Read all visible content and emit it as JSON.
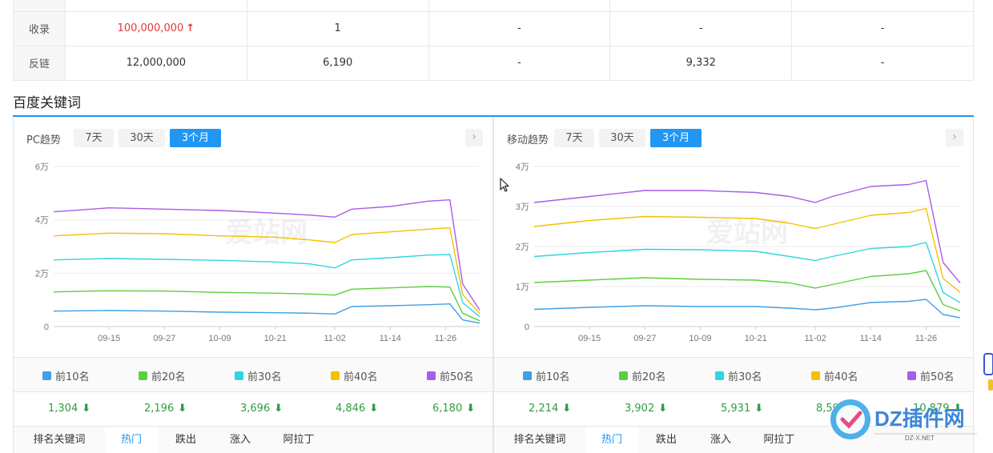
{
  "top_table": {
    "rows": [
      {
        "label": "收录",
        "values": [
          "100,000,000",
          "1",
          "-",
          "-",
          "-"
        ],
        "first_red": true,
        "first_arrow": "↑"
      },
      {
        "label": "反链",
        "values": [
          "12,000,000",
          "6,190",
          "-",
          "9,332",
          "-"
        ]
      }
    ]
  },
  "section_title": "百度关键词",
  "colors": {
    "accent": "#2196f3",
    "top10": "#3fa0e6",
    "top20": "#5ccf3f",
    "top30": "#2fd6e0",
    "top40": "#f2c200",
    "top50": "#a95ce8",
    "down": "#2e9e3e",
    "red": "#e4393c"
  },
  "pc": {
    "title": "PC趋势",
    "tabs": [
      "7天",
      "30天",
      "3个月"
    ],
    "active_tab": "3个月",
    "next_icon": "chevron-right-icon",
    "legend": [
      "前10名",
      "前20名",
      "前30名",
      "前40名",
      "前50名"
    ],
    "values": [
      "1,304",
      "2,196",
      "3,696",
      "4,846",
      "6,180"
    ],
    "subtabs": [
      "排名关键词",
      "热门",
      "跌出",
      "涨入",
      "阿拉丁"
    ],
    "active_subtab": "热门"
  },
  "mobile": {
    "title": "移动趋势",
    "tabs": [
      "7天",
      "30天",
      "3个月"
    ],
    "active_tab": "3个月",
    "next_icon": "chevron-right-icon",
    "legend": [
      "前10名",
      "前20名",
      "前30名",
      "前40名",
      "前50名"
    ],
    "values": [
      "2,214",
      "3,902",
      "5,931",
      "8,59",
      "10,879"
    ],
    "subtabs": [
      "排名关键词",
      "热门",
      "跌出",
      "涨入",
      "阿拉丁"
    ],
    "active_subtab": "热门"
  },
  "chart_data": [
    {
      "type": "line",
      "title": "PC趋势",
      "x_ticks": [
        "09-15",
        "09-27",
        "10-09",
        "10-21",
        "11-02",
        "11-14",
        "11-26"
      ],
      "y_ticks": [
        "0",
        "2万",
        "4万",
        "6万"
      ],
      "ylim": [
        0,
        60000
      ],
      "x_range": [
        0,
        100
      ],
      "tick_positions": [
        13,
        26,
        39,
        52,
        66,
        79,
        92
      ],
      "series": [
        {
          "name": "前10名",
          "points": [
            [
              0,
              5800
            ],
            [
              13,
              6000
            ],
            [
              26,
              5800
            ],
            [
              39,
              5400
            ],
            [
              52,
              5200
            ],
            [
              60,
              5000
            ],
            [
              66,
              4700
            ],
            [
              70,
              7500
            ],
            [
              79,
              7800
            ],
            [
              88,
              8200
            ],
            [
              93,
              8500
            ],
            [
              96,
              2500
            ],
            [
              100,
              1304
            ]
          ]
        },
        {
          "name": "前20名",
          "points": [
            [
              0,
              13000
            ],
            [
              13,
              13400
            ],
            [
              26,
              13300
            ],
            [
              39,
              12800
            ],
            [
              52,
              12500
            ],
            [
              60,
              12200
            ],
            [
              66,
              11800
            ],
            [
              70,
              14000
            ],
            [
              79,
              14500
            ],
            [
              88,
              15000
            ],
            [
              93,
              14800
            ],
            [
              96,
              5000
            ],
            [
              100,
              2196
            ]
          ]
        },
        {
          "name": "前30名",
          "points": [
            [
              0,
              25000
            ],
            [
              13,
              25500
            ],
            [
              26,
              25200
            ],
            [
              39,
              24800
            ],
            [
              52,
              24200
            ],
            [
              60,
              23500
            ],
            [
              66,
              22000
            ],
            [
              70,
              25000
            ],
            [
              79,
              25800
            ],
            [
              88,
              26800
            ],
            [
              93,
              27000
            ],
            [
              96,
              9000
            ],
            [
              100,
              3696
            ]
          ]
        },
        {
          "name": "前40名",
          "points": [
            [
              0,
              34000
            ],
            [
              13,
              35000
            ],
            [
              26,
              34800
            ],
            [
              39,
              34000
            ],
            [
              52,
              33500
            ],
            [
              60,
              32500
            ],
            [
              66,
              31500
            ],
            [
              70,
              34500
            ],
            [
              79,
              35500
            ],
            [
              88,
              36500
            ],
            [
              93,
              37000
            ],
            [
              96,
              12000
            ],
            [
              100,
              4846
            ]
          ]
        },
        {
          "name": "前50名",
          "points": [
            [
              0,
              43000
            ],
            [
              13,
              44500
            ],
            [
              26,
              44000
            ],
            [
              39,
              43500
            ],
            [
              52,
              42500
            ],
            [
              60,
              41800
            ],
            [
              66,
              41000
            ],
            [
              70,
              44000
            ],
            [
              79,
              45000
            ],
            [
              88,
              47000
            ],
            [
              93,
              47500
            ],
            [
              96,
              16000
            ],
            [
              100,
              6180
            ]
          ]
        }
      ]
    },
    {
      "type": "line",
      "title": "移动趋势",
      "x_ticks": [
        "09-15",
        "09-27",
        "10-09",
        "10-21",
        "11-02",
        "11-14",
        "11-26"
      ],
      "y_ticks": [
        "0",
        "1万",
        "2万",
        "3万",
        "4万"
      ],
      "ylim": [
        0,
        40000
      ],
      "x_range": [
        0,
        100
      ],
      "tick_positions": [
        13,
        26,
        39,
        52,
        66,
        79,
        92
      ],
      "series": [
        {
          "name": "前10名",
          "points": [
            [
              0,
              4300
            ],
            [
              13,
              4800
            ],
            [
              26,
              5200
            ],
            [
              39,
              5000
            ],
            [
              52,
              5000
            ],
            [
              60,
              4600
            ],
            [
              66,
              4200
            ],
            [
              70,
              4600
            ],
            [
              79,
              6000
            ],
            [
              88,
              6300
            ],
            [
              92,
              6800
            ],
            [
              96,
              3000
            ],
            [
              100,
              2214
            ]
          ]
        },
        {
          "name": "前20名",
          "points": [
            [
              0,
              11000
            ],
            [
              13,
              11600
            ],
            [
              26,
              12200
            ],
            [
              39,
              11800
            ],
            [
              52,
              11600
            ],
            [
              60,
              10900
            ],
            [
              66,
              9600
            ],
            [
              70,
              10500
            ],
            [
              79,
              12500
            ],
            [
              88,
              13200
            ],
            [
              92,
              14000
            ],
            [
              96,
              5500
            ],
            [
              100,
              3902
            ]
          ]
        },
        {
          "name": "前30名",
          "points": [
            [
              0,
              17500
            ],
            [
              13,
              18500
            ],
            [
              26,
              19300
            ],
            [
              39,
              19200
            ],
            [
              52,
              18800
            ],
            [
              60,
              17500
            ],
            [
              66,
              16500
            ],
            [
              70,
              17500
            ],
            [
              79,
              19500
            ],
            [
              88,
              20000
            ],
            [
              92,
              21000
            ],
            [
              96,
              8500
            ],
            [
              100,
              5931
            ]
          ]
        },
        {
          "name": "前40名",
          "points": [
            [
              0,
              25000
            ],
            [
              13,
              26500
            ],
            [
              26,
              27500
            ],
            [
              39,
              27300
            ],
            [
              52,
              27000
            ],
            [
              60,
              25800
            ],
            [
              66,
              24500
            ],
            [
              70,
              25500
            ],
            [
              79,
              27800
            ],
            [
              88,
              28500
            ],
            [
              92,
              29500
            ],
            [
              96,
              12000
            ],
            [
              100,
              8590
            ]
          ]
        },
        {
          "name": "前50名",
          "points": [
            [
              0,
              31000
            ],
            [
              13,
              32500
            ],
            [
              26,
              34000
            ],
            [
              39,
              34000
            ],
            [
              52,
              33500
            ],
            [
              60,
              32500
            ],
            [
              66,
              31000
            ],
            [
              70,
              32500
            ],
            [
              79,
              35000
            ],
            [
              88,
              35500
            ],
            [
              92,
              36500
            ],
            [
              96,
              16000
            ],
            [
              100,
              10879
            ]
          ]
        }
      ]
    }
  ],
  "watermark": {
    "text": "DZ插件网",
    "sub": "DZ-X.NET",
    "chart_text": "爱站网"
  }
}
